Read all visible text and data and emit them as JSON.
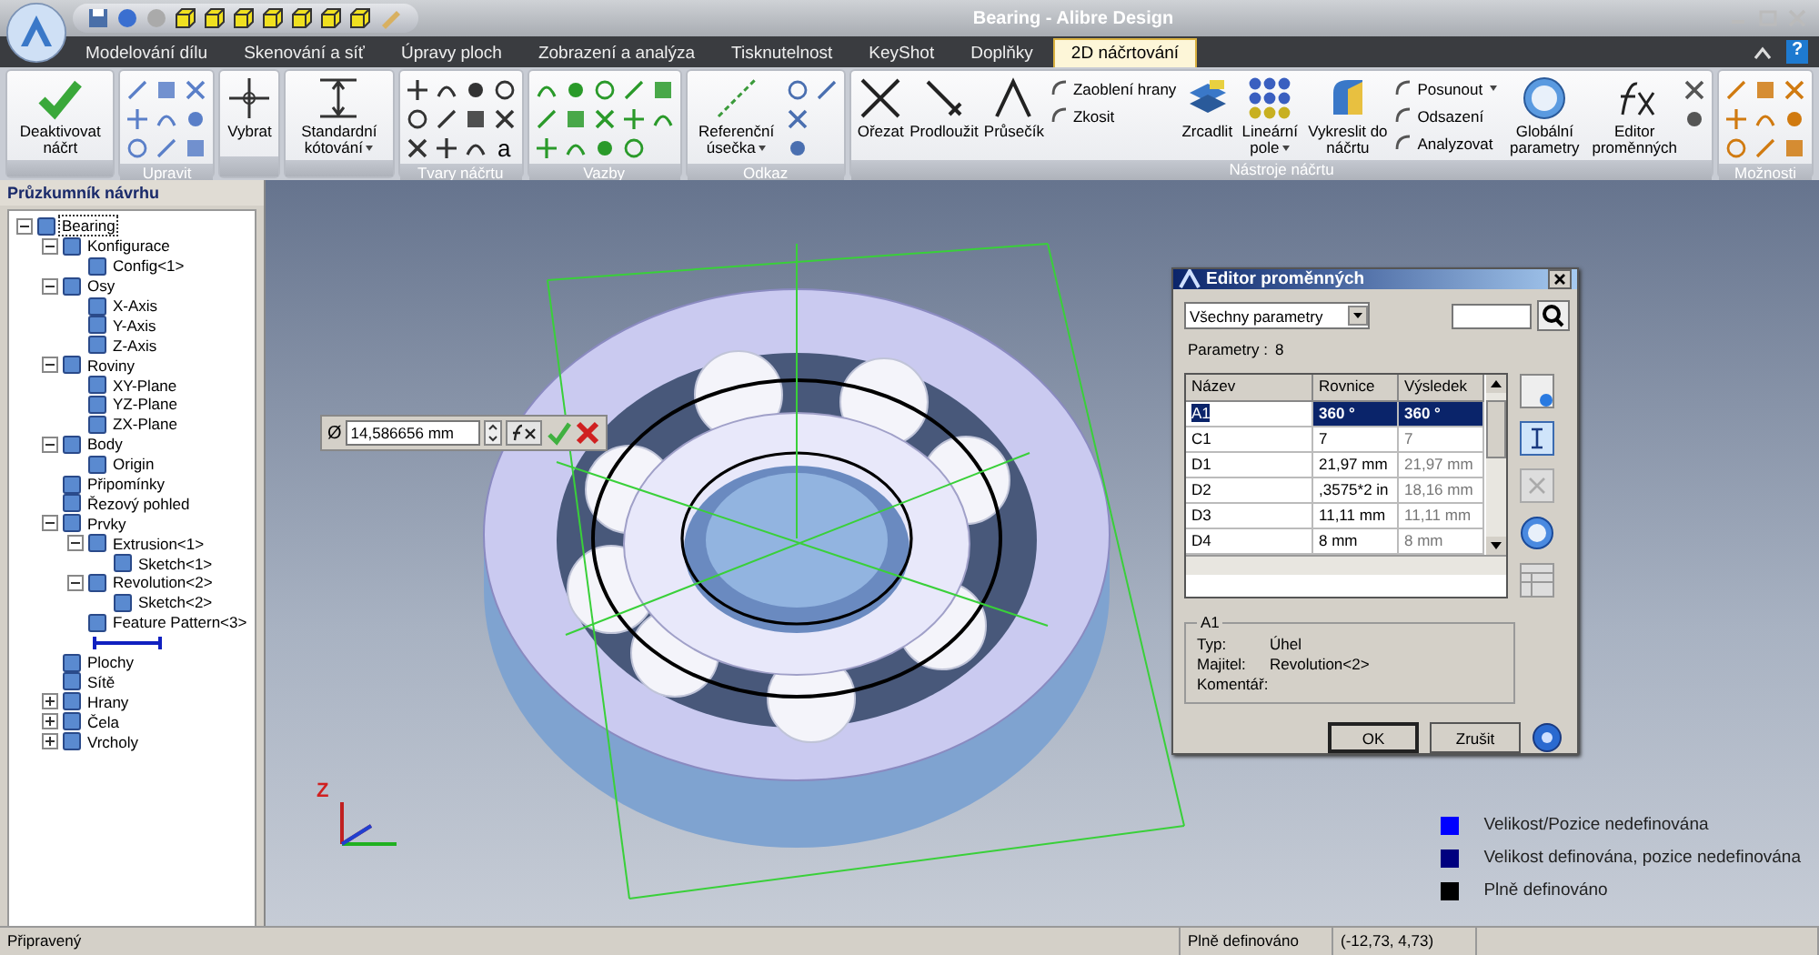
{
  "window": {
    "title": "Bearing - Alibre Design"
  },
  "tabs": [
    {
      "label": "Modelování dílu",
      "selected": false
    },
    {
      "label": "Skenování a síť",
      "selected": false
    },
    {
      "label": "Úpravy ploch",
      "selected": false
    },
    {
      "label": "Zobrazení a analýza",
      "selected": false
    },
    {
      "label": "Tisknutelnost",
      "selected": false
    },
    {
      "label": "KeyShot",
      "selected": false
    },
    {
      "label": "Doplňky",
      "selected": false
    },
    {
      "label": "2D náčrtování",
      "selected": true
    }
  ],
  "help": "?",
  "ribbon": [
    {
      "tools": [
        {
          "kind": "large",
          "label": "Deaktivovat náčrt"
        }
      ]
    },
    {
      "label": "Upravit",
      "tools": [
        {
          "kind": "icon"
        },
        {
          "kind": "icon"
        },
        {
          "kind": "icon"
        },
        {
          "kind": "icon"
        },
        {
          "kind": "icon"
        },
        {
          "kind": "icon"
        },
        {
          "kind": "icon"
        },
        {
          "kind": "icon"
        },
        {
          "kind": "icon"
        }
      ]
    },
    {
      "tools": [
        {
          "kind": "large",
          "label": "Vybrat"
        }
      ]
    },
    {
      "tools": [
        {
          "kind": "large",
          "label": "Standardní kótování",
          "dropdown": true
        }
      ]
    },
    {
      "label": "Tvary náčrtu",
      "tools": [
        {
          "kind": "icon"
        },
        {
          "kind": "icon"
        },
        {
          "kind": "icon"
        },
        {
          "kind": "icon"
        },
        {
          "kind": "icon"
        },
        {
          "kind": "icon"
        },
        {
          "kind": "icon"
        },
        {
          "kind": "icon"
        },
        {
          "kind": "icon"
        },
        {
          "kind": "icon"
        },
        {
          "kind": "icon"
        },
        {
          "kind": "glyph",
          "label": "a"
        }
      ]
    },
    {
      "label": "Vazby",
      "tools": [
        {
          "kind": "icon"
        },
        {
          "kind": "icon"
        },
        {
          "kind": "icon"
        },
        {
          "kind": "icon"
        },
        {
          "kind": "icon"
        },
        {
          "kind": "icon"
        },
        {
          "kind": "icon"
        },
        {
          "kind": "icon"
        },
        {
          "kind": "icon"
        },
        {
          "kind": "icon"
        },
        {
          "kind": "icon"
        },
        {
          "kind": "icon"
        },
        {
          "kind": "icon"
        },
        {
          "kind": "icon"
        }
      ]
    },
    {
      "label": "Odkaz",
      "tools": [
        {
          "kind": "large",
          "label": "Referenční úsečka",
          "dropdown": true
        },
        {
          "kind": "icon"
        },
        {
          "kind": "icon"
        },
        {
          "kind": "icon"
        },
        {
          "kind": "icon"
        }
      ]
    },
    {
      "label": "Nástroje náčrtu",
      "tools": [
        {
          "kind": "large",
          "label": "Ořezat"
        },
        {
          "kind": "large",
          "label": "Prodloužit"
        },
        {
          "kind": "large",
          "label": "Průsečík"
        },
        {
          "kind": "small",
          "label": "Zaoblení hrany"
        },
        {
          "kind": "small",
          "label": "Zkosit"
        },
        {
          "kind": "large",
          "label": "Zrcadlit"
        },
        {
          "kind": "large",
          "label": "Lineární pole",
          "dropdown": true
        },
        {
          "kind": "large",
          "label": "Vykreslit do náčrtu"
        },
        {
          "kind": "small",
          "label": "Posunout",
          "dropdown": true
        },
        {
          "kind": "small",
          "label": "Odsazení"
        },
        {
          "kind": "small",
          "label": "Analyzovat"
        },
        {
          "kind": "large",
          "label": "Globální parametry"
        },
        {
          "kind": "large",
          "label": "Editor proměnných"
        },
        {
          "kind": "icon"
        },
        {
          "kind": "icon"
        }
      ]
    },
    {
      "label": "Možnosti",
      "tools": [
        {
          "kind": "icon"
        },
        {
          "kind": "icon"
        },
        {
          "kind": "icon"
        },
        {
          "kind": "icon"
        },
        {
          "kind": "icon"
        },
        {
          "kind": "icon"
        },
        {
          "kind": "icon"
        },
        {
          "kind": "icon"
        },
        {
          "kind": "icon"
        }
      ]
    }
  ],
  "panel": {
    "title": "Průzkumník návrhu",
    "tree": [
      {
        "label": "Bearing",
        "expanded": true,
        "selected": true,
        "children": [
          {
            "label": "Konfigurace",
            "expanded": true,
            "selected": false,
            "children": [
              {
                "label": "Config<1>",
                "selected": false
              }
            ]
          },
          {
            "label": "Osy",
            "expanded": true,
            "selected": false,
            "children": [
              {
                "label": "X-Axis",
                "selected": false
              },
              {
                "label": "Y-Axis",
                "selected": false
              },
              {
                "label": "Z-Axis",
                "selected": false
              }
            ]
          },
          {
            "label": "Roviny",
            "expanded": true,
            "selected": false,
            "children": [
              {
                "label": "XY-Plane",
                "selected": false
              },
              {
                "label": "YZ-Plane",
                "selected": false
              },
              {
                "label": "ZX-Plane",
                "selected": false
              }
            ]
          },
          {
            "label": "Body",
            "expanded": true,
            "selected": false,
            "children": [
              {
                "label": "Origin",
                "selected": false
              }
            ]
          },
          {
            "label": "Připomínky",
            "selected": false
          },
          {
            "label": "Řezový pohled",
            "selected": false
          },
          {
            "label": "Prvky",
            "expanded": true,
            "selected": false,
            "rollback_bar": true,
            "children": [
              {
                "label": "Extrusion<1>",
                "expanded": true,
                "selected": false,
                "children": [
                  {
                    "label": "Sketch<1>",
                    "selected": false
                  }
                ]
              },
              {
                "label": "Revolution<2>",
                "expanded": true,
                "selected": false,
                "children": [
                  {
                    "label": "Sketch<2>",
                    "selected": false
                  }
                ]
              },
              {
                "label": "Feature Pattern<3>",
                "selected": false
              }
            ]
          },
          {
            "label": "Plochy",
            "selected": false
          },
          {
            "label": "Sítě",
            "selected": false
          },
          {
            "label": "Hrany",
            "expanded": false,
            "selected": false
          },
          {
            "label": "Čela",
            "expanded": false,
            "selected": false
          },
          {
            "label": "Vrcholy",
            "expanded": false,
            "selected": false
          }
        ]
      }
    ]
  },
  "dimension_input": {
    "symbol": "Ø",
    "value": "14,586656 mm"
  },
  "dialog": {
    "title": "Editor proměnných",
    "filter": "Všechny parametry",
    "count_label": "Parametry :",
    "count": "8",
    "columns": [
      "Název",
      "Rovnice",
      "Výsledek"
    ],
    "rows": [
      {
        "name": "A1",
        "equation": "360 °",
        "result": "360 °",
        "selected": true
      },
      {
        "name": "C1",
        "equation": "7",
        "result": "7",
        "selected": false
      },
      {
        "name": "D1",
        "equation": "21,97 mm",
        "result": "21,97 mm",
        "selected": false
      },
      {
        "name": "D2",
        "equation": ",3575*2 in",
        "result": "18,16 mm",
        "selected": false
      },
      {
        "name": "D3",
        "equation": "11,11 mm",
        "result": "11,11 mm",
        "selected": false
      },
      {
        "name": "D4",
        "equation": "8 mm",
        "result": "8 mm",
        "selected": false
      }
    ],
    "details": {
      "title": "A1",
      "fields": [
        {
          "label": "Typ:",
          "value": "Úhel"
        },
        {
          "label": "Majitel:",
          "value": "Revolution<2>"
        },
        {
          "label": "Komentář:"
        }
      ]
    },
    "buttons": [
      "OK",
      "Zrušit"
    ]
  },
  "legend": [
    {
      "label": "Velikost/Pozice nedefinována",
      "color": "#0000ff"
    },
    {
      "label": "Velikost definována, pozice nedefinována",
      "color": "#00007f"
    },
    {
      "label": "Plně definováno",
      "color": "#000000"
    }
  ],
  "triad": {
    "label": "Z"
  },
  "status_bar": [
    "Připravený",
    "Plně definováno",
    "(-12,73, 4,73)"
  ]
}
